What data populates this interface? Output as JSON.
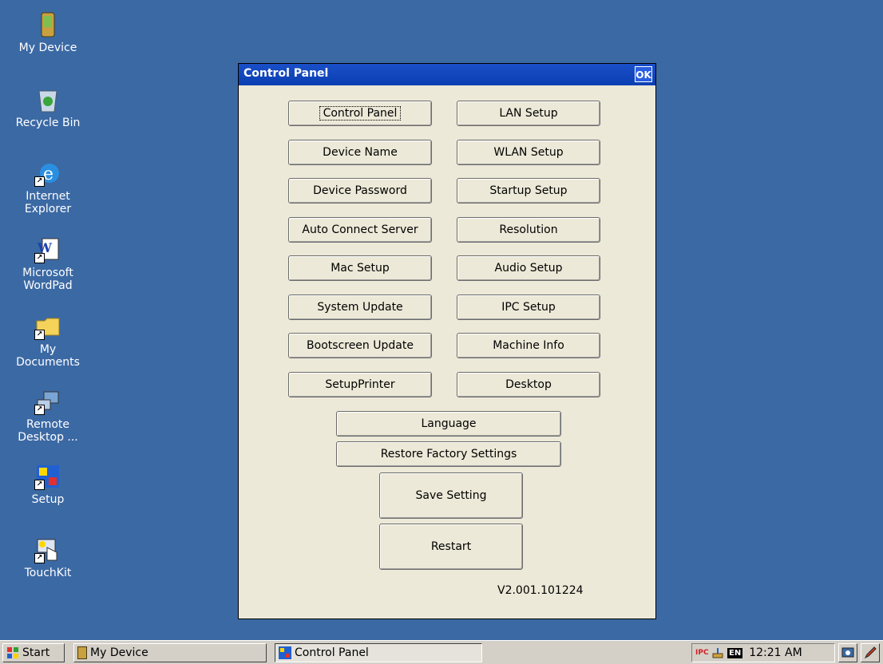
{
  "desktop": {
    "icons": [
      {
        "label": "My Device"
      },
      {
        "label": "Recycle Bin"
      },
      {
        "label": "Internet Explorer"
      },
      {
        "label": "Microsoft WordPad"
      },
      {
        "label": "My Documents"
      },
      {
        "label": "Remote Desktop ..."
      },
      {
        "label": "Setup"
      },
      {
        "label": "TouchKit"
      }
    ]
  },
  "dialog": {
    "title": "Control Panel",
    "ok_label": "OK",
    "left_buttons": [
      "Control Panel",
      "Device Name",
      "Device Password",
      "Auto Connect Server",
      "Mac Setup",
      "System Update",
      "Bootscreen Update",
      "SetupPrinter"
    ],
    "right_buttons": [
      "LAN Setup",
      "WLAN Setup",
      "Startup Setup",
      "Resolution",
      "Audio Setup",
      "IPC Setup",
      "Machine Info",
      "Desktop"
    ],
    "language_label": "Language",
    "restore_label": "Restore Factory Settings",
    "save_label": "Save Setting",
    "restart_label": "Restart",
    "version": "V2.001.101224"
  },
  "taskbar": {
    "start_label": "Start",
    "items": [
      "My Device",
      "Control Panel"
    ],
    "tray": {
      "ipc_label": "IPC",
      "language_label": "EN",
      "time": "12:21 AM"
    }
  },
  "colors": {
    "desktop": "#3b69a4",
    "titlebar": "#0a3fb3",
    "dialog": "#ece9d8",
    "taskbar": "#d4d0c8"
  }
}
